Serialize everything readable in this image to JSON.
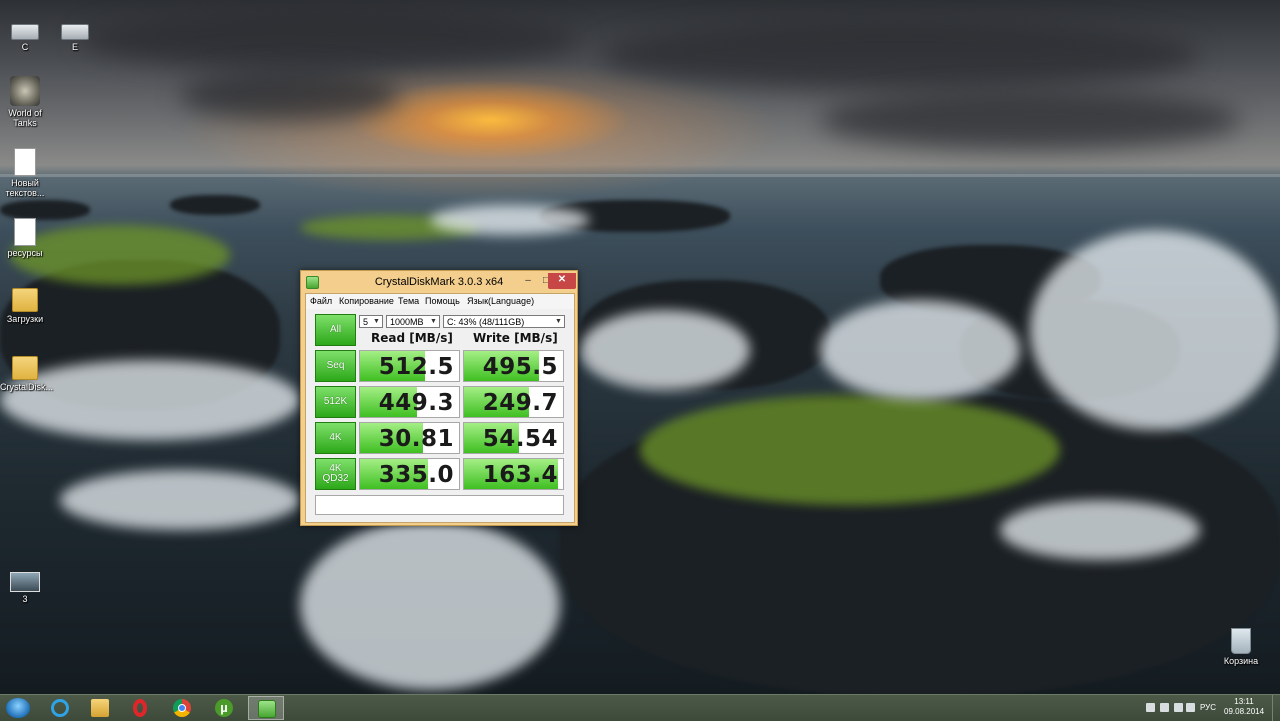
{
  "desktop": {
    "icons": [
      {
        "label": "C"
      },
      {
        "label": "E"
      },
      {
        "label": "World of Tanks"
      },
      {
        "label": "Новый текстов..."
      },
      {
        "label": "ресурсы"
      },
      {
        "label": "Загрузки"
      },
      {
        "label": "CrystalDisk..."
      },
      {
        "label": "3"
      },
      {
        "label": "Корзина"
      }
    ]
  },
  "window": {
    "title": "CrystalDiskMark 3.0.3 x64",
    "minimize": "–",
    "maximize": "□",
    "close": "✕",
    "menu": [
      "Файл",
      "Копирование",
      "Тема",
      "Помощь",
      "Язык(Language)"
    ],
    "controls": {
      "count": "5",
      "size": "1000MB",
      "drive": "C: 43% (48/111GB)"
    },
    "all_button": "All",
    "read_header": "Read [MB/s]",
    "write_header": "Write [MB/s]",
    "rows": [
      {
        "label": "Seq",
        "read": "512.5",
        "write": "495.5",
        "read_fill": 0.66,
        "write_fill": 0.76
      },
      {
        "label": "512K",
        "read": "449.3",
        "write": "249.7",
        "read_fill": 0.58,
        "write_fill": 0.66
      },
      {
        "label": "4K",
        "read": "30.81",
        "write": "54.54",
        "read_fill": 0.64,
        "write_fill": 0.56
      },
      {
        "label": "4K\nQD32",
        "read": "335.0",
        "write": "163.4",
        "read_fill": 0.69,
        "write_fill": 0.95
      }
    ],
    "comment": "",
    "accent_color": "#3fbf22",
    "frame_color": "#f3ce8c"
  },
  "taskbar": {
    "apps": [
      {
        "name": "internet-explorer-icon"
      },
      {
        "name": "file-explorer-icon"
      },
      {
        "name": "opera-icon"
      },
      {
        "name": "chrome-icon"
      },
      {
        "name": "utorrent-icon"
      },
      {
        "name": "crystaldiskmark-icon"
      }
    ],
    "language": "РУС",
    "time": "13:11",
    "date": "09.08.2014"
  }
}
